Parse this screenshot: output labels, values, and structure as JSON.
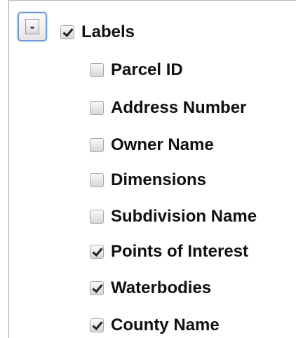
{
  "tree": {
    "collapse_button_label": "-",
    "root": {
      "label": "Labels",
      "checked": true
    },
    "items": [
      {
        "label": "Parcel ID",
        "checked": false
      },
      {
        "label": "Address Number",
        "checked": false
      },
      {
        "label": "Owner Name",
        "checked": false
      },
      {
        "label": "Dimensions",
        "checked": false
      },
      {
        "label": "Subdivision Name",
        "checked": false
      },
      {
        "label": "Points of Interest",
        "checked": true
      },
      {
        "label": "Waterbodies",
        "checked": true
      },
      {
        "label": "County Name",
        "checked": true
      }
    ]
  }
}
